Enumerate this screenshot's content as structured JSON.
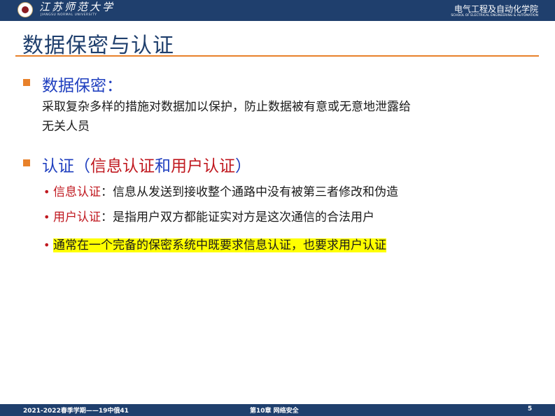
{
  "header": {
    "logo_name": "江苏师范大学",
    "logo_sub": "JIANGSU NORMAL UNIVERSITY",
    "school_cn": "电气工程及自动化学院",
    "school_en": "SCHOOL OF ELECTRICAL ENGINEERING & AUTOMATION"
  },
  "slide": {
    "title": "数据保密与认证",
    "section1": {
      "heading": "数据保密：",
      "line1": "采取复杂多样的措施对数据加以保护，防止数据被有意或无意地泄露给",
      "line2": "无关人员"
    },
    "section2": {
      "heading_a": "认证（",
      "heading_b": "信息认证",
      "heading_c": "和",
      "heading_d": "用户认证",
      "heading_e": "）",
      "items": [
        {
          "term": "信息认证",
          "text": "：信息从发送到接收整个通路中没有被第三者修改和伪造"
        },
        {
          "term": "用户认证",
          "text": "：是指用户双方都能证实对方是这次通信的合法用户"
        },
        {
          "text": "通常在一个完备的保密系统中既要求信息认证，也要求用户认证"
        }
      ]
    },
    "bullet_glyph": "•"
  },
  "footer": {
    "left": "2021-2022春季学期——19中俄41",
    "center": "第10章 网络安全",
    "page": "5"
  },
  "colors": {
    "bar": "#1f3f6d",
    "accent": "#e8812a",
    "heading_blue": "#1f3fbf",
    "term_red": "#c0181f",
    "highlight": "#ffff00"
  }
}
